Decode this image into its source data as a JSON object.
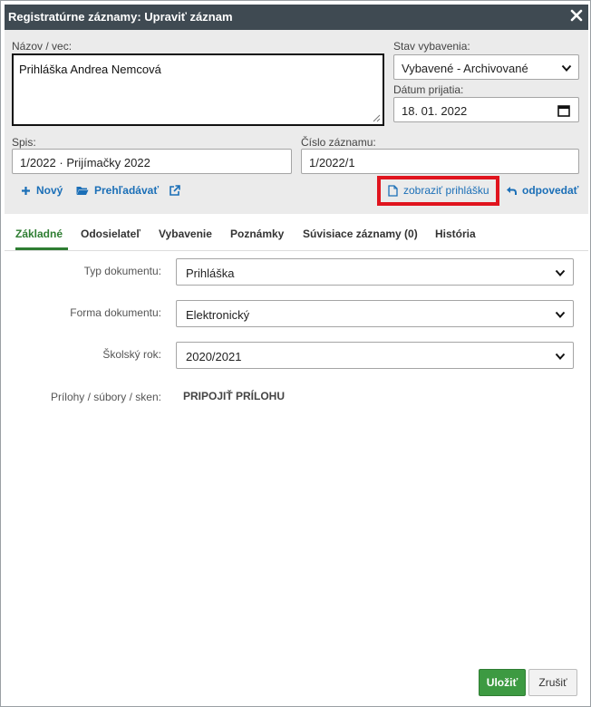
{
  "dialog": {
    "title": "Registratúrne záznamy: Upraviť záznam",
    "close_icon": "close-icon"
  },
  "header_fields": {
    "name_label": "Názov / vec:",
    "name_value": "Prihláška Andrea Nemcová",
    "status_label": "Stav vybavenia:",
    "status_value": "Vybavené - Archivované",
    "date_label": "Dátum prijatia:",
    "date_value": "18. 01. 2022",
    "file_label": "Spis:",
    "file_value": "1/2022 · Prijímačky 2022",
    "number_label": "Číslo záznamu:",
    "number_value": "1/2022/1"
  },
  "actions": {
    "new_label": "Nový",
    "browse_label": "Prehľadávať",
    "show_application_label": "zobraziť prihlášku",
    "reply_label": "odpovedať"
  },
  "tabs": [
    {
      "label": "Základné"
    },
    {
      "label": "Odosielateľ"
    },
    {
      "label": "Vybavenie"
    },
    {
      "label": "Poznámky"
    },
    {
      "label": "Súvisiace záznamy (0)"
    },
    {
      "label": "História"
    }
  ],
  "form": {
    "doc_type_label": "Typ dokumentu:",
    "doc_type_value": "Prihláška",
    "doc_form_label": "Forma dokumentu:",
    "doc_form_value": "Elektronický",
    "school_year_label": "Školský rok:",
    "school_year_value": "2020/2021",
    "attachments_label": "Prílohy / súbory / sken:",
    "attach_button_label": "PRIPOJIŤ PRÍLOHU"
  },
  "footer": {
    "save_label": "Uložiť",
    "cancel_label": "Zrušiť"
  },
  "colors": {
    "titlebar": "#3f4a52",
    "link": "#1b6fb7",
    "accent_green": "#2e7d32",
    "highlight_red": "#e0141e"
  }
}
